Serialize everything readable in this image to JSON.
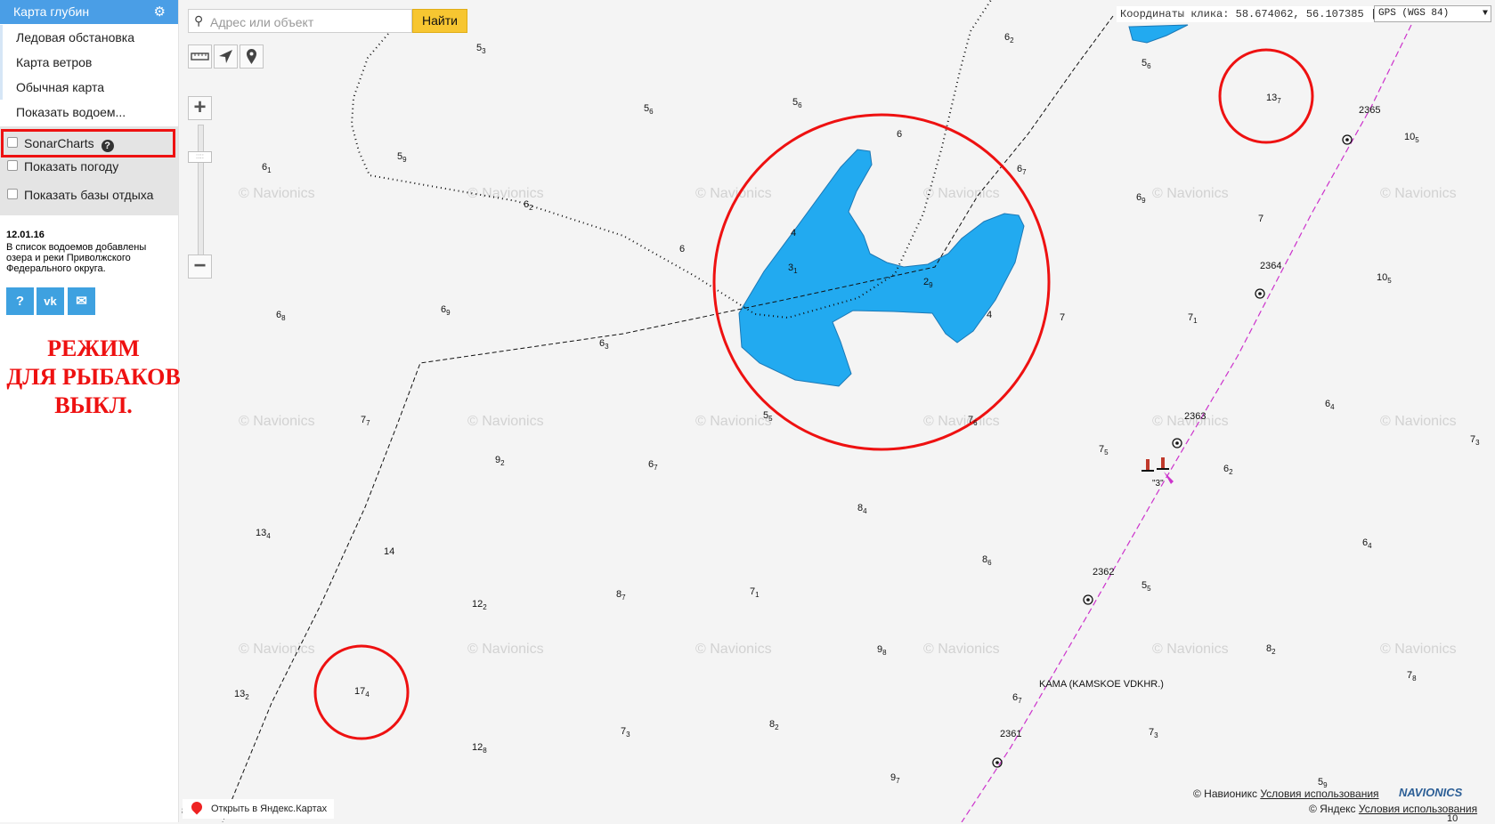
{
  "sidebar": {
    "active_map": "Карта глубин",
    "menu_items": [
      "Ледовая обстановка",
      "Карта ветров",
      "Обычная карта",
      "Показать водоем..."
    ],
    "options": [
      {
        "label": "SonarCharts",
        "checked": false
      },
      {
        "label": "Показать погоду",
        "checked": false
      },
      {
        "label": "Показать базы отдыха",
        "checked": false
      }
    ],
    "news_date": "12.01.16",
    "news_text": "В список водоемов добавлены озера и реки Приволжского Федерального округа.",
    "social_buttons": [
      {
        "icon": "question-icon",
        "glyph": "?"
      },
      {
        "icon": "vk-icon",
        "glyph": "vk"
      },
      {
        "icon": "mail-icon",
        "glyph": "✉"
      }
    ],
    "fishing_mode_lines": [
      "РЕЖИМ",
      "ДЛЯ РЫБАКОВ",
      "ВЫКЛ."
    ]
  },
  "search": {
    "placeholder": "Адрес или объект",
    "value": "",
    "button": "Найти"
  },
  "toolbar": {
    "tools": [
      "ruler-icon",
      "navigation-arrow-icon",
      "location-pin-icon"
    ]
  },
  "zoom": {
    "plus": "+",
    "minus": "−"
  },
  "coords": {
    "label": "Координаты клика:",
    "value": "58.674062, 56.107385",
    "system": "GPS (WGS 84)"
  },
  "map": {
    "watermark": "© Navionics",
    "river_name": "KAMA (KAMSKOE VDKHR.)",
    "buoy_label": "\"3\"",
    "channel_markers": [
      "2365",
      "2364",
      "2363",
      "2362",
      "2361"
    ],
    "depths": [
      {
        "d": "5",
        "s": "3"
      },
      {
        "d": "6",
        "s": "2"
      },
      {
        "d": "5",
        "s": "6"
      },
      {
        "d": "5",
        "s": "6"
      },
      {
        "d": "5",
        "s": "6"
      },
      {
        "d": "13",
        "s": "7"
      },
      {
        "d": "6",
        "s": ""
      },
      {
        "d": "10",
        "s": "5"
      },
      {
        "d": "5",
        "s": "9"
      },
      {
        "d": "6",
        "s": "1"
      },
      {
        "d": "6",
        "s": "2"
      },
      {
        "d": "6",
        "s": "7"
      },
      {
        "d": "6",
        "s": "9"
      },
      {
        "d": "7",
        "s": ""
      },
      {
        "d": "4",
        "s": ""
      },
      {
        "d": "6",
        "s": ""
      },
      {
        "d": "3",
        "s": "1"
      },
      {
        "d": "2",
        "s": "9"
      },
      {
        "d": "10",
        "s": "5"
      },
      {
        "d": "6",
        "s": "8"
      },
      {
        "d": "6",
        "s": "9"
      },
      {
        "d": "6",
        "s": "3"
      },
      {
        "d": "4",
        "s": ""
      },
      {
        "d": "7",
        "s": ""
      },
      {
        "d": "7",
        "s": "1"
      },
      {
        "d": "7",
        "s": "7"
      },
      {
        "d": "5",
        "s": "5"
      },
      {
        "d": "7",
        "s": "6"
      },
      {
        "d": "6",
        "s": "4"
      },
      {
        "d": "7",
        "s": "3"
      },
      {
        "d": "9",
        "s": "2"
      },
      {
        "d": "6",
        "s": "7"
      },
      {
        "d": "7",
        "s": "5"
      },
      {
        "d": "6",
        "s": "2"
      },
      {
        "d": "8",
        "s": "4"
      },
      {
        "d": "13",
        "s": "4"
      },
      {
        "d": "14",
        "s": ""
      },
      {
        "d": "6",
        "s": "4"
      },
      {
        "d": "8",
        "s": "6"
      },
      {
        "d": "5",
        "s": "5"
      },
      {
        "d": "12",
        "s": "2"
      },
      {
        "d": "8",
        "s": "7"
      },
      {
        "d": "7",
        "s": "1"
      },
      {
        "d": "9",
        "s": "8"
      },
      {
        "d": "8",
        "s": "2"
      },
      {
        "d": "7",
        "s": "8"
      },
      {
        "d": "13",
        "s": "2"
      },
      {
        "d": "17",
        "s": "4"
      },
      {
        "d": "6",
        "s": "7"
      },
      {
        "d": "7",
        "s": "3"
      },
      {
        "d": "8",
        "s": "2"
      },
      {
        "d": "7",
        "s": "3"
      },
      {
        "d": "12",
        "s": "8"
      },
      {
        "d": "9",
        "s": "7"
      },
      {
        "d": "5",
        "s": "9"
      }
    ]
  },
  "bottom": {
    "yandex_link": "Открыть в Яндекс.Картах",
    "navionics_attr": "© Навионикс",
    "yandex_attr": "© Яндекс",
    "terms": "Условия использования",
    "logo": "NAVIONICS",
    "left_mark": "8",
    "right_mark": "10"
  },
  "colors": {
    "accent": "#4a9ee6",
    "water": "#22aaf0",
    "highlight": "#ee1111",
    "channel": "#cc33cc",
    "find_button": "#f7c631"
  }
}
